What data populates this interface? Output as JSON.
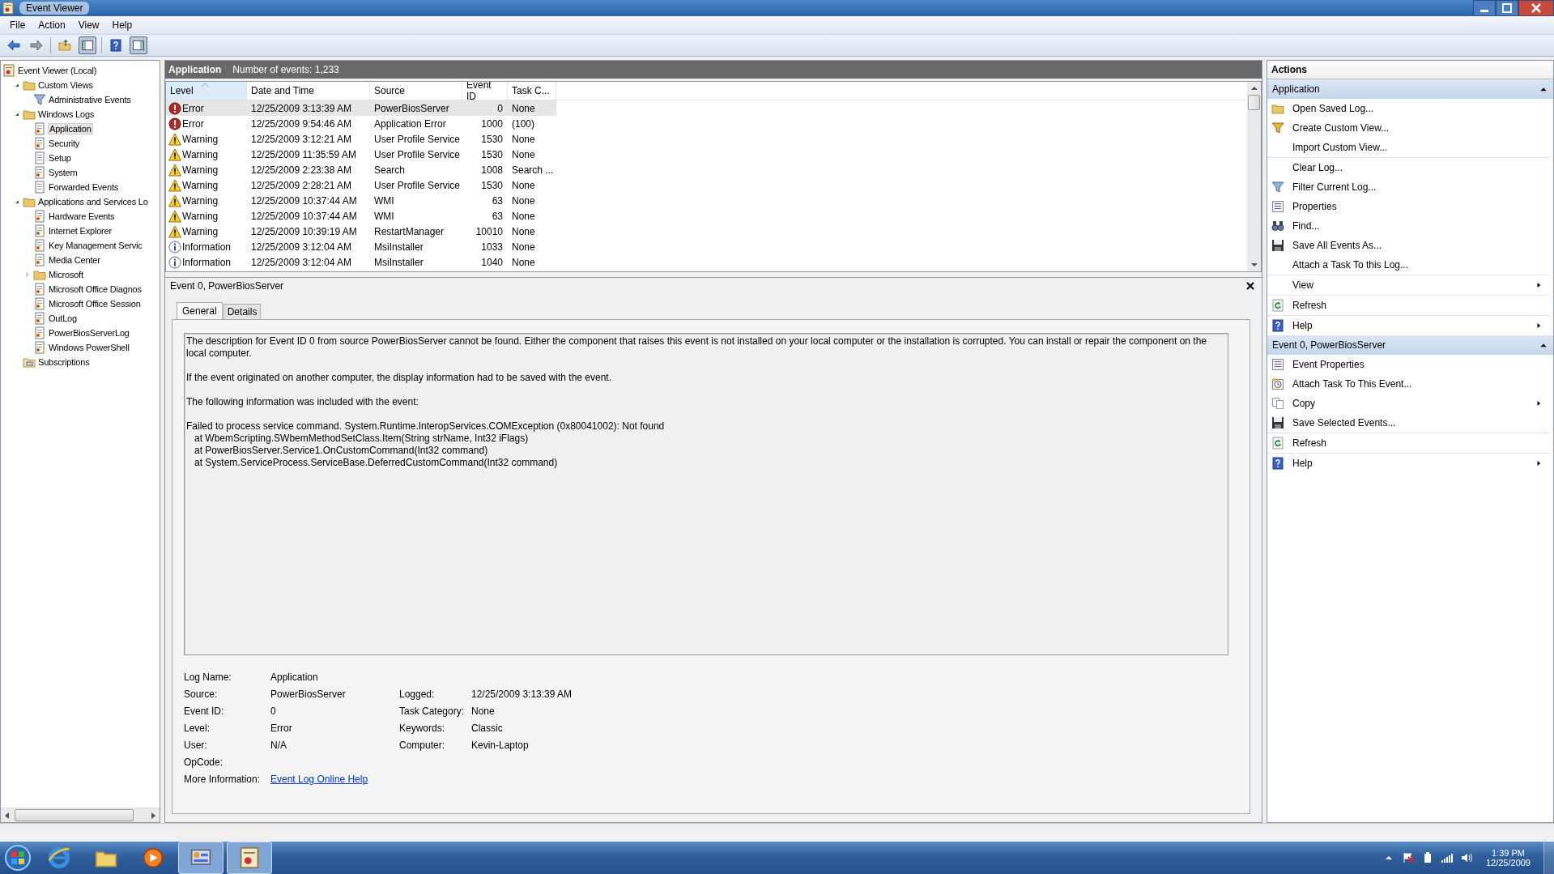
{
  "window": {
    "title": "Event Viewer"
  },
  "menu": [
    "File",
    "Action",
    "View",
    "Help"
  ],
  "toolbar": [
    {
      "kind": "back",
      "pressed": false
    },
    {
      "kind": "forward",
      "pressed": false
    },
    {
      "kind": "separator"
    },
    {
      "kind": "up",
      "pressed": false
    },
    {
      "kind": "tree",
      "pressed": true
    },
    {
      "kind": "separator"
    },
    {
      "kind": "help",
      "pressed": false
    },
    {
      "kind": "pane",
      "pressed": true
    }
  ],
  "tree": [
    {
      "label": "Event Viewer (Local)",
      "kind": "root",
      "selected": false,
      "children": [
        {
          "label": "Custom Views",
          "kind": "folder",
          "expanded": true,
          "selected": false,
          "children": [
            {
              "label": "Administrative Events",
              "kind": "filter",
              "selected": false
            }
          ]
        },
        {
          "label": "Windows Logs",
          "kind": "folder",
          "expanded": true,
          "selected": false,
          "children": [
            {
              "label": "Application",
              "kind": "log",
              "selected": true
            },
            {
              "label": "Security",
              "kind": "log",
              "selected": false
            },
            {
              "label": "Setup",
              "kind": "page",
              "selected": false
            },
            {
              "label": "System",
              "kind": "log",
              "selected": false
            },
            {
              "label": "Forwarded Events",
              "kind": "page",
              "selected": false
            }
          ]
        },
        {
          "label": "Applications and Services Lo",
          "kind": "folder",
          "expanded": true,
          "selected": false,
          "children": [
            {
              "label": "Hardware Events",
              "kind": "log",
              "selected": false
            },
            {
              "label": "Internet Explorer",
              "kind": "log",
              "selected": false
            },
            {
              "label": "Key Management Servic",
              "kind": "log",
              "selected": false
            },
            {
              "label": "Media Center",
              "kind": "log",
              "selected": false
            },
            {
              "label": "Microsoft",
              "kind": "folder",
              "expanded": false,
              "selected": false
            },
            {
              "label": "Microsoft Office Diagnos",
              "kind": "log",
              "selected": false
            },
            {
              "label": "Microsoft Office Session",
              "kind": "log",
              "selected": false
            },
            {
              "label": "OutLog",
              "kind": "log",
              "selected": false
            },
            {
              "label": "PowerBiosServerLog",
              "kind": "log",
              "selected": false
            },
            {
              "label": "Windows PowerShell",
              "kind": "log",
              "selected": false
            }
          ]
        },
        {
          "label": "Subscriptions",
          "kind": "subs",
          "selected": false
        }
      ]
    }
  ],
  "log_header": {
    "name": "Application",
    "count": "Number of events: 1,233"
  },
  "table": {
    "columns": [
      {
        "label": "Level",
        "sorted": true
      },
      {
        "label": "Date and Time",
        "sorted": false
      },
      {
        "label": "Source",
        "sorted": false
      },
      {
        "label": "Event ID",
        "sorted": false
      },
      {
        "label": "Task C...",
        "sorted": false
      }
    ],
    "rows": [
      {
        "kind": "error",
        "selected": true,
        "cells": [
          "Error",
          "12/25/2009 3:13:39 AM",
          "PowerBiosServer",
          "0",
          "None"
        ]
      },
      {
        "kind": "error",
        "selected": false,
        "cells": [
          "Error",
          "12/25/2009 9:54:46 AM",
          "Application Error",
          "1000",
          "(100)"
        ]
      },
      {
        "kind": "warning",
        "selected": false,
        "cells": [
          "Warning",
          "12/25/2009 3:12:21 AM",
          "User Profile Service",
          "1530",
          "None"
        ]
      },
      {
        "kind": "warning",
        "selected": false,
        "cells": [
          "Warning",
          "12/25/2009 11:35:59 AM",
          "User Profile Service",
          "1530",
          "None"
        ]
      },
      {
        "kind": "warning",
        "selected": false,
        "cells": [
          "Warning",
          "12/25/2009 2:23:38 AM",
          "Search",
          "1008",
          "Search ..."
        ]
      },
      {
        "kind": "warning",
        "selected": false,
        "cells": [
          "Warning",
          "12/25/2009 2:28:21 AM",
          "User Profile Service",
          "1530",
          "None"
        ]
      },
      {
        "kind": "warning",
        "selected": false,
        "cells": [
          "Warning",
          "12/25/2009 10:37:44 AM",
          "WMI",
          "63",
          "None"
        ]
      },
      {
        "kind": "warning",
        "selected": false,
        "cells": [
          "Warning",
          "12/25/2009 10:37:44 AM",
          "WMI",
          "63",
          "None"
        ]
      },
      {
        "kind": "warning",
        "selected": false,
        "cells": [
          "Warning",
          "12/25/2009 10:39:19 AM",
          "RestartManager",
          "10010",
          "None"
        ]
      },
      {
        "kind": "information",
        "selected": false,
        "cells": [
          "Information",
          "12/25/2009 3:12:04 AM",
          "MsiInstaller",
          "1033",
          "None"
        ]
      },
      {
        "kind": "information",
        "selected": false,
        "cells": [
          "Information",
          "12/25/2009 3:12:04 AM",
          "MsiInstaller",
          "1040",
          "None"
        ]
      }
    ]
  },
  "detail": {
    "title": "Event 0, PowerBiosServer",
    "tabs": [
      {
        "label": "General",
        "selected": true
      },
      {
        "label": "Details",
        "selected": false
      }
    ],
    "description": [
      "The description for Event ID 0 from source PowerBiosServer cannot be found. Either the component that raises this event is not installed on your local computer or the installation is corrupted. You can install or repair the component on the local computer.",
      "If the event originated on another computer, the display information had to be saved with the event.",
      "The following information was included with the event:",
      "Failed to process service command. System.Runtime.InteropServices.COMException (0x80041002): Not found\n   at WbemScripting.SWbemMethodSetClass.Item(String strName, Int32 iFlags)\n   at PowerBiosServer.Service1.OnCustomCommand(Int32 command)\n   at System.ServiceProcess.ServiceBase.DeferredCustomCommand(Int32 command)"
    ],
    "fields": [
      {
        "label": "Log Name:",
        "value": "Application"
      },
      {
        "label": "Source:",
        "value": "PowerBiosServer",
        "label2": "Logged:",
        "value2": "12/25/2009 3:13:39 AM"
      },
      {
        "label": "Event ID:",
        "value": "0",
        "label2": "Task Category:",
        "value2": "None"
      },
      {
        "label": "Level:",
        "value": "Error",
        "label2": "Keywords:",
        "value2": "Classic"
      },
      {
        "label": "User:",
        "value": "N/A",
        "label2": "Computer:",
        "value2": "Kevin-Laptop"
      },
      {
        "label": "OpCode:"
      },
      {
        "label": "More Information:",
        "link": "Event Log Online Help"
      }
    ]
  },
  "actions": {
    "title": "Actions",
    "sections": [
      {
        "title": "Application",
        "expanded": true,
        "items": [
          {
            "label": "Open Saved Log...",
            "kind": "folder",
            "submenu": false,
            "separator_after": false
          },
          {
            "label": "Create Custom View...",
            "kind": "funnel-star",
            "submenu": false,
            "separator_after": false
          },
          {
            "label": "Import Custom View...",
            "kind": "plain",
            "submenu": false,
            "separator_after": true
          },
          {
            "label": "Clear Log...",
            "kind": "plain",
            "submenu": false,
            "separator_after": false
          },
          {
            "label": "Filter Current Log...",
            "kind": "funnel",
            "submenu": false,
            "separator_after": false
          },
          {
            "label": "Properties",
            "kind": "properties",
            "submenu": false,
            "separator_after": false
          },
          {
            "label": "Find...",
            "kind": "binoculars",
            "submenu": false,
            "separator_after": false
          },
          {
            "label": "Save All Events As...",
            "kind": "floppy",
            "submenu": false,
            "separator_after": false
          },
          {
            "label": "Attach a Task To this Log...",
            "kind": "plain",
            "submenu": false,
            "separator_after": true
          },
          {
            "label": "View",
            "kind": "plain",
            "submenu": true,
            "separator_after": true
          },
          {
            "label": "Refresh",
            "kind": "refresh",
            "submenu": false,
            "separator_after": true
          },
          {
            "label": "Help",
            "kind": "help",
            "submenu": true,
            "separator_after": false
          }
        ]
      },
      {
        "title": "Event 0, PowerBiosServer",
        "expanded": true,
        "items": [
          {
            "label": "Event Properties",
            "kind": "properties",
            "submenu": false,
            "separator_after": false
          },
          {
            "label": "Attach Task To This Event...",
            "kind": "clock",
            "submenu": false,
            "separator_after": false
          },
          {
            "label": "Copy",
            "kind": "copy",
            "submenu": true,
            "separator_after": false
          },
          {
            "label": "Save Selected Events...",
            "kind": "floppy",
            "submenu": false,
            "separator_after": true
          },
          {
            "label": "Refresh",
            "kind": "refresh",
            "submenu": false,
            "separator_after": true
          },
          {
            "label": "Help",
            "kind": "help",
            "submenu": true,
            "separator_after": false
          }
        ]
      }
    ]
  },
  "taskbar": {
    "apps": [
      {
        "kind": "ie",
        "active": false
      },
      {
        "kind": "folder",
        "active": false
      },
      {
        "kind": "media",
        "active": false
      },
      {
        "kind": "control",
        "active": true
      },
      {
        "kind": "eventviewer",
        "active": true
      }
    ],
    "time": "1:39 PM",
    "date": "12/25/2009"
  }
}
